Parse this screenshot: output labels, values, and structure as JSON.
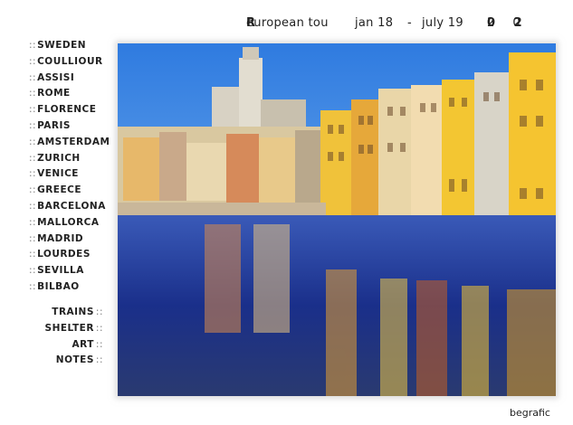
{
  "header": {
    "title_pre": "european tou",
    "title_bold": "R",
    "start_date": "jan 18",
    "dash": "-",
    "end_date": "july 19",
    "year_pre": "2 0",
    "year_bold": "0 2"
  },
  "menu_separator": "::",
  "destinations": [
    "SWEDEN",
    "COULLIOUR",
    "ASSISI",
    "ROME",
    "FLORENCE",
    "PARIS",
    "AMSTERDAM",
    "ZURICH",
    "VENICE",
    "GREECE",
    "BARCELONA",
    "MALLORCA",
    "MADRID",
    "LOURDES",
    "SEVILLA",
    "BILBAO"
  ],
  "sections": [
    "TRAINS",
    "SHELTER",
    "ART",
    "NOTES"
  ],
  "credit": "begrafic",
  "colors": {
    "sky": "#4a8fe0",
    "water": "#1e3c8c",
    "building_yellow": "#f2c12e",
    "building_cream": "#e8d7a4"
  }
}
